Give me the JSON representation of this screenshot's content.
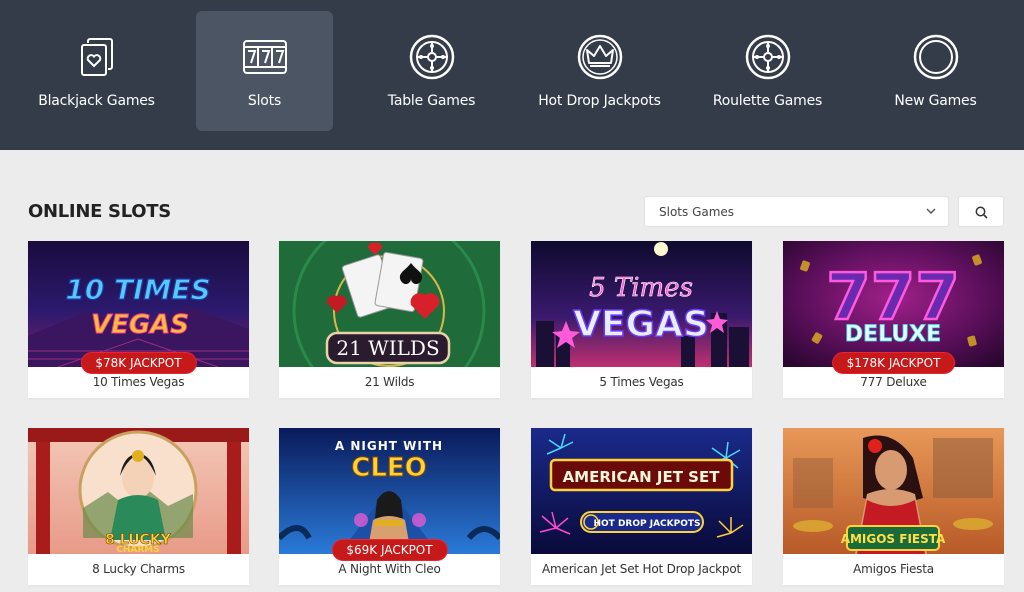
{
  "nav": {
    "items": [
      {
        "label": "Blackjack Games",
        "icon": "cards-icon",
        "active": false
      },
      {
        "label": "Slots",
        "icon": "slot-777-icon",
        "active": true
      },
      {
        "label": "Table Games",
        "icon": "roulette-wheel-icon",
        "active": false
      },
      {
        "label": "Hot Drop Jackpots",
        "icon": "crown-icon",
        "active": false
      },
      {
        "label": "Roulette Games",
        "icon": "roulette-wheel-icon",
        "active": false
      },
      {
        "label": "New Games",
        "icon": "ring-icon",
        "active": false
      }
    ]
  },
  "section": {
    "title": "ONLINE SLOTS",
    "filter_value": "Slots Games"
  },
  "games": [
    {
      "name": "10 Times Vegas",
      "jackpot": "$78K JACKPOT",
      "art_text": [
        "10 TIMES",
        "VEGAS"
      ]
    },
    {
      "name": "21 Wilds",
      "jackpot": "",
      "art_text": [
        "21 WILDS"
      ]
    },
    {
      "name": "5 Times Vegas",
      "jackpot": "",
      "art_text": [
        "5 Times",
        "VEGAS"
      ]
    },
    {
      "name": "777 Deluxe",
      "jackpot": "$178K JACKPOT",
      "art_text": [
        "777",
        "DELUXE"
      ]
    },
    {
      "name": "8 Lucky Charms",
      "jackpot": "",
      "art_text": [
        "8 LUCKY",
        "CHARMS"
      ]
    },
    {
      "name": "A Night With Cleo",
      "jackpot": "$69K JACKPOT",
      "art_text": [
        "A NIGHT WITH",
        "CLEO"
      ]
    },
    {
      "name": "American Jet Set Hot Drop Jackpot",
      "jackpot": "",
      "art_text": [
        "AMERICAN JET SET",
        "HOT DROP JACKPOTS"
      ]
    },
    {
      "name": "Amigos Fiesta",
      "jackpot": "",
      "art_text": [
        "AMIGOS FIESTA"
      ]
    }
  ],
  "colors": {
    "nav_bg": "#343c4a",
    "nav_active": "#4c5564",
    "page_bg": "#ececec",
    "jackpot_red": "#c61a1a"
  }
}
